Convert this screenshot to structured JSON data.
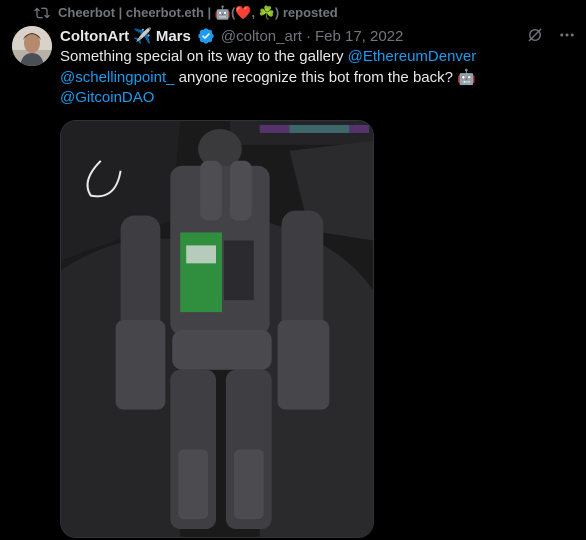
{
  "repost": {
    "icon": "repost-icon",
    "text": "Cheerbot | cheerbot.eth | 🤖(❤️, ☘️) reposted"
  },
  "author": {
    "display_name": "ColtonArt",
    "plane_emoji": "✈️",
    "name_suffix": "Mars",
    "verified": true,
    "handle": "@colton_art",
    "separator": "·",
    "date": "Feb 17, 2022"
  },
  "tweet": {
    "text_1": "Something special on its way to the gallery ",
    "mention_1": "@EthereumDenver",
    "mention_2": "@schellingpoint_",
    "text_2": " anyone recognize this bot from the back? ",
    "robot_emoji": "🤖",
    "mention_3": "@GitcoinDAO"
  },
  "actions": {
    "grok_icon": "grok-icon",
    "more_icon": "more-icon"
  },
  "colors": {
    "background": "#000000",
    "text": "#e7e9ea",
    "muted": "#71767b",
    "link": "#1d9bf0"
  }
}
